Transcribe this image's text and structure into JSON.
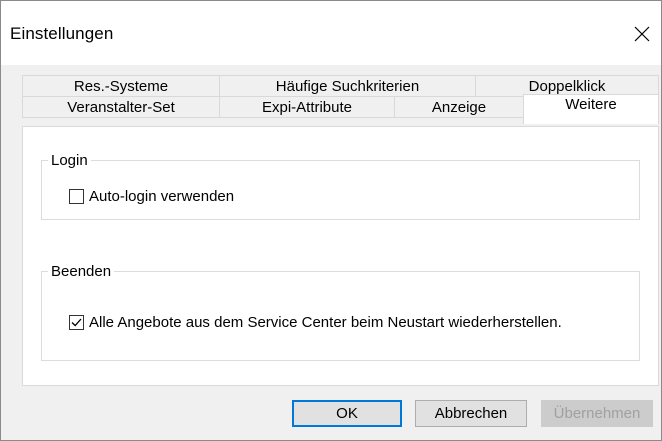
{
  "window": {
    "title": "Einstellungen",
    "close_icon": "close-icon"
  },
  "tabs": {
    "row_top": [
      "Res.-Systeme",
      "Häufige Suchkriterien",
      "Doppelklick"
    ],
    "row_bottom": [
      "Veranstalter-Set",
      "Expi-Attribute",
      "Anzeige",
      "Weitere"
    ],
    "active": "Weitere"
  },
  "login": {
    "legend": "Login",
    "auto_login_label": "Auto-login verwenden",
    "auto_login_checked": false
  },
  "beenden": {
    "legend": "Beenden",
    "restore_label": "Alle Angebote aus dem Service Center beim Neustart wiederherstellen.",
    "restore_checked": true
  },
  "buttons": {
    "ok": "OK",
    "cancel": "Abbrechen",
    "apply": "Übernehmen",
    "apply_enabled": false
  },
  "colors": {
    "accent": "#0078d7",
    "window_bg": "#f0f0f0",
    "panel_bg": "#ffffff"
  }
}
